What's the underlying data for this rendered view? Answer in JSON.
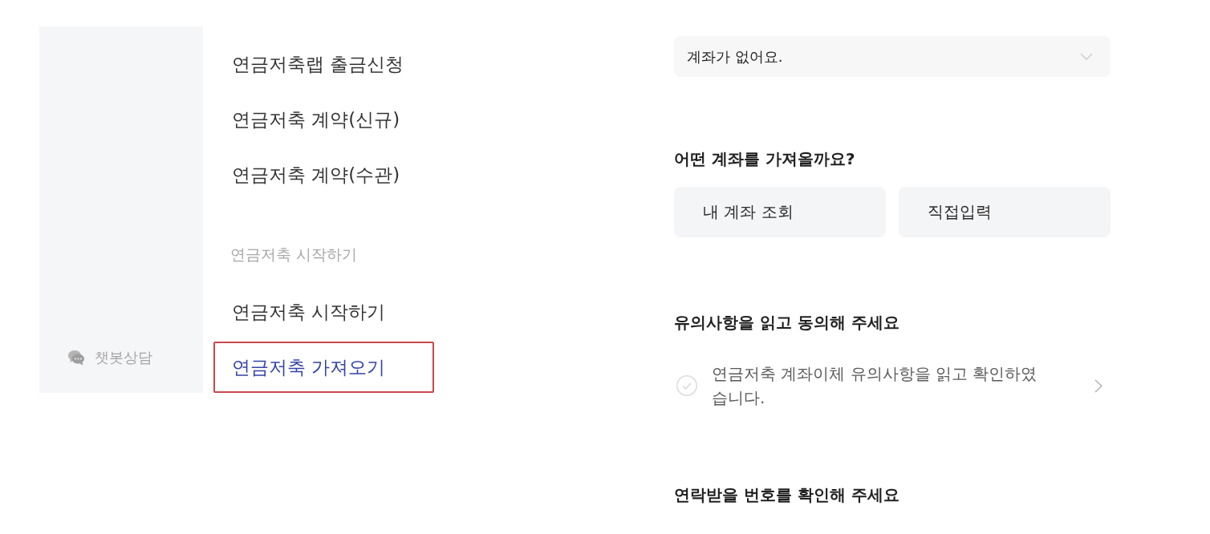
{
  "sidebar": {
    "chatbot_label": "챗봇상담"
  },
  "menu": {
    "groups": [
      {
        "items": [
          {
            "label": "연금저축랩 출금신청",
            "selected": false,
            "highlighted": false
          },
          {
            "label": "연금저축 계약(신규)",
            "selected": false,
            "highlighted": false
          },
          {
            "label": "연금저축 계약(수관)",
            "selected": false,
            "highlighted": false
          }
        ]
      },
      {
        "heading": "연금저축 시작하기",
        "items": [
          {
            "label": "연금저축 시작하기",
            "selected": false,
            "highlighted": false
          },
          {
            "label": "연금저축 가져오기",
            "selected": true,
            "highlighted": true
          }
        ]
      }
    ]
  },
  "form": {
    "account_select": {
      "value": "계좌가 없어요."
    },
    "account_source": {
      "heading": "어떤 계좌를 가져올까요?",
      "options": [
        {
          "label": "내 계좌 조회",
          "selected": false
        },
        {
          "label": "직접입력",
          "selected": false
        }
      ]
    },
    "agreement": {
      "heading": "유의사항을 읽고 동의해 주세요",
      "items": [
        {
          "label": "연금저축 계좌이체 유의사항을 읽고 확인하였습니다.",
          "checked": false
        }
      ]
    },
    "contact": {
      "heading": "연락받을 번호를 확인해 주세요"
    }
  }
}
